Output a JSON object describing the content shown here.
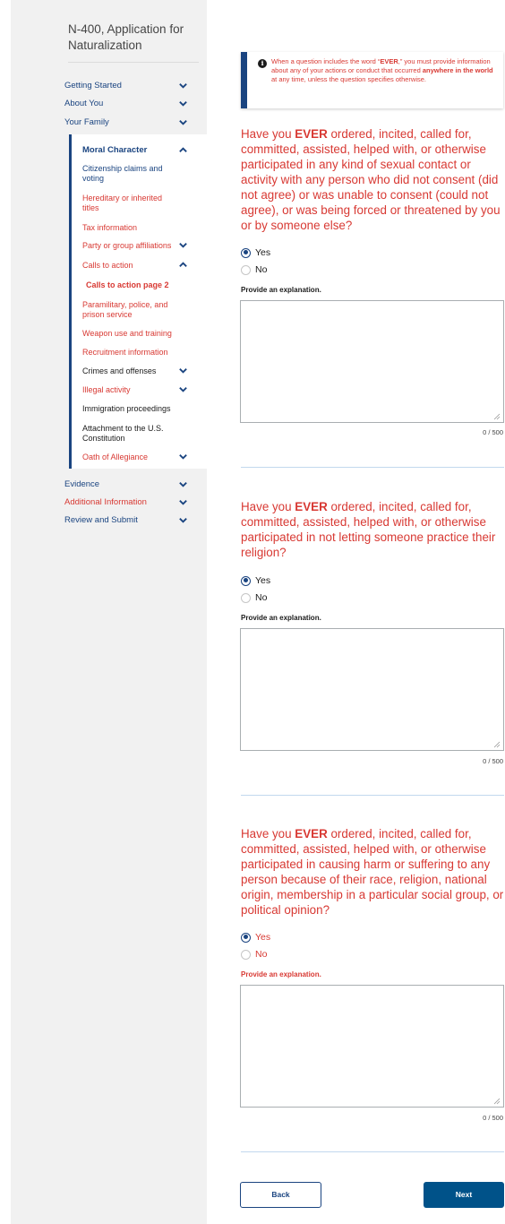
{
  "app": {
    "title": "N-400, Application for Naturalization"
  },
  "nav": {
    "top_items": [
      {
        "label": "Getting Started",
        "state": "collapsed"
      },
      {
        "label": "About You",
        "state": "collapsed"
      },
      {
        "label": "Your Family",
        "state": "collapsed"
      }
    ],
    "active_section": {
      "label": "Moral Character",
      "state": "expanded",
      "items": [
        {
          "label": "Citizenship claims and voting"
        },
        {
          "label": "Hereditary or inherited titles"
        },
        {
          "label": "Tax information"
        },
        {
          "label": "Party or group affiliations",
          "state": "collapsed"
        },
        {
          "label": "Calls to action",
          "state": "expanded"
        },
        {
          "label": "Calls to action page 2",
          "current": true
        },
        {
          "label": "Paramilitary, police, and prison service"
        },
        {
          "label": "Weapon use and training"
        },
        {
          "label": "Recruitment information"
        },
        {
          "label": "Crimes and offenses",
          "state": "collapsed"
        },
        {
          "label": "Illegal activity",
          "state": "collapsed"
        },
        {
          "label": "Immigration proceedings"
        },
        {
          "label": "Attachment to the U.S. Constitution"
        },
        {
          "label": "Oath of Allegiance",
          "state": "collapsed"
        }
      ]
    },
    "bottom_items": [
      {
        "label": "Evidence",
        "state": "collapsed"
      },
      {
        "label": "Additional Information",
        "state": "collapsed"
      },
      {
        "label": "Review and Submit",
        "state": "collapsed"
      }
    ]
  },
  "alert": {
    "icon": "info-icon",
    "text_1": "When a question includes the word “",
    "text_bold_1": "EVER",
    "text_2": ",” you must provide information about any of your actions or conduct that occurred ",
    "text_bold_2": "anywhere in the world",
    "text_3": " at any time, unless the question specifies otherwise."
  },
  "questions": [
    {
      "prefix": "Have you ",
      "emphasis": "EVER",
      "suffix": " ordered, incited, called for, committed, assisted, helped with, or otherwise participated in any kind of sexual contact or activity with any person who did not consent (did not agree) or was unable to consent (could not agree), or was being forced or threatened by you or by someone else?",
      "option_yes": "Yes",
      "option_no": "No",
      "selected": "Yes",
      "explanation_label": "Provide an explanation.",
      "explanation_value": "",
      "counter": "0 / 500"
    },
    {
      "prefix": "Have you ",
      "emphasis": "EVER",
      "suffix": " ordered, incited, called for, committed, assisted, helped with, or otherwise participated in not letting someone practice their religion?",
      "option_yes": "Yes",
      "option_no": "No",
      "selected": "Yes",
      "explanation_label": "Provide an explanation.",
      "explanation_value": "",
      "counter": "0 / 500"
    },
    {
      "prefix": "Have you ",
      "emphasis": "EVER",
      "suffix": " ordered, incited, called for, committed, assisted, helped with, or otherwise participated in causing harm or suffering to any person because of their race, religion, national origin, membership in a particular social group, or political opinion?",
      "option_yes": "Yes",
      "option_no": "No",
      "selected": "Yes",
      "explanation_label": "Provide an explanation.",
      "explanation_value": "",
      "counter": "0 / 500"
    }
  ],
  "buttons": {
    "back": "Back",
    "next": "Next"
  },
  "colors": {
    "primary": "#1a4480",
    "error": "#d83933",
    "button": "#005289",
    "sidebar": "#f1f1f1"
  }
}
